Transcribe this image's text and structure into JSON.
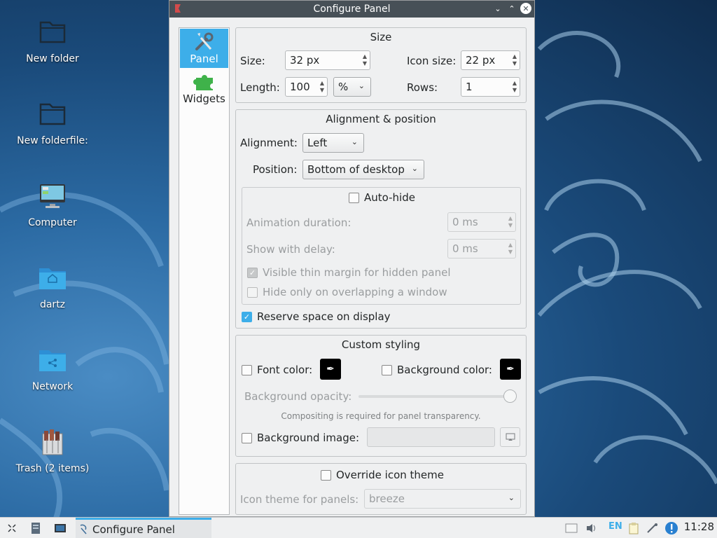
{
  "desktop": {
    "icons": [
      {
        "label": "New folder"
      },
      {
        "label": "New folderfile:"
      },
      {
        "label": "Computer"
      },
      {
        "label": "dartz"
      },
      {
        "label": "Network"
      },
      {
        "label": "Trash (2 items)"
      }
    ]
  },
  "window": {
    "title": "Configure Panel",
    "sidebar": [
      {
        "label": "Panel",
        "icon": "wrench-screwdriver-icon",
        "active": true
      },
      {
        "label": "Widgets",
        "icon": "puzzle-icon",
        "active": false
      }
    ],
    "size": {
      "title": "Size",
      "size_label": "Size:",
      "size_value": "32 px",
      "icon_size_label": "Icon size:",
      "icon_size_value": "22 px",
      "length_label": "Length:",
      "length_value": "100",
      "length_unit": "%",
      "rows_label": "Rows:",
      "rows_value": "1"
    },
    "alignment": {
      "title": "Alignment & position",
      "alignment_label": "Alignment:",
      "alignment_value": "Left",
      "position_label": "Position:",
      "position_value": "Bottom of desktop",
      "autohide_label": "Auto-hide",
      "autohide_checked": false,
      "anim_label": "Animation duration:",
      "anim_value": "0 ms",
      "delay_label": "Show with delay:",
      "delay_value": "0 ms",
      "thin_margin_label": "Visible thin margin for hidden panel",
      "thin_margin_checked": true,
      "overlap_label": "Hide only on overlapping a window",
      "overlap_checked": false,
      "reserve_label": "Reserve space on display",
      "reserve_checked": true
    },
    "styling": {
      "title": "Custom styling",
      "font_color_label": "Font color:",
      "bg_color_label": "Background color:",
      "opacity_label": "Background opacity:",
      "opacity_value": 1.0,
      "compositing_note": "Compositing is required for panel transparency.",
      "bg_image_label": "Background image:",
      "bg_image_value": ""
    },
    "icon_theme": {
      "override_label": "Override icon theme",
      "theme_label": "Icon theme for panels:",
      "theme_value": "breeze"
    }
  },
  "taskbar": {
    "task_label": "Configure Panel",
    "keyboard_layout": "EN",
    "clock": "11:28"
  },
  "colors": {
    "accent": "#3daee9",
    "titlebar": "#475057",
    "window_bg": "#eff0f1"
  }
}
